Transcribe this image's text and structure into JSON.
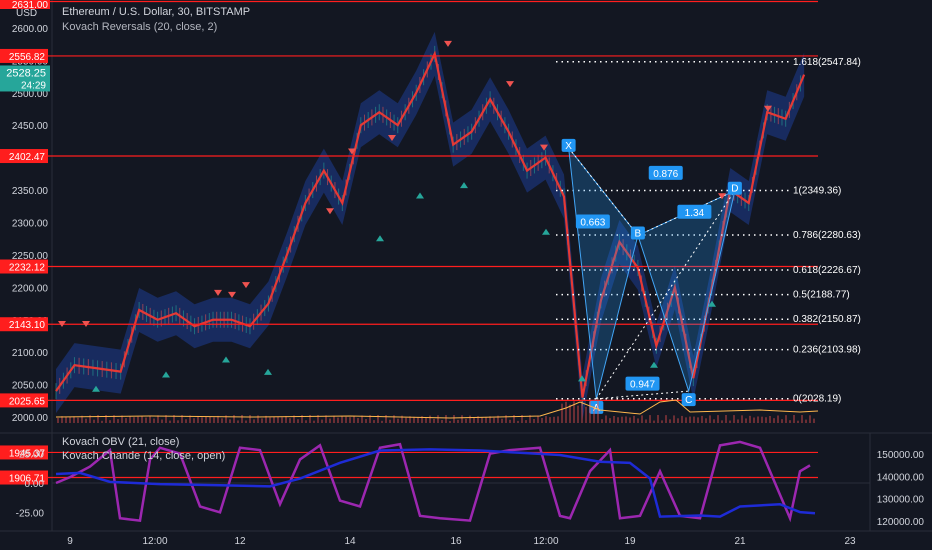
{
  "header": {
    "title": "Ethereum / U.S. Dollar, 30, BITSTAMP",
    "indicator": "Kovach Reversals (20, close, 2)",
    "currency": "USD"
  },
  "lower_pane": {
    "indicator_1": "Kovach OBV (21, close)",
    "indicator_2": "Kovach Chande (14, close, open)"
  },
  "price_axis": {
    "ticks": [
      "2600.00",
      "2550.00",
      "2500.00",
      "2450.00",
      "2400.00",
      "2350.00",
      "2300.00",
      "2250.00",
      "2200.00",
      "2150.00",
      "2100.00",
      "2050.00",
      "2000.00"
    ],
    "top_tag": "2631.00",
    "last_price": "2528.25",
    "countdown": "24:29",
    "red_tags": [
      "2556.82",
      "2402.47",
      "2232.12",
      "2143.10",
      "2025.65",
      "1945.37",
      "1906.71"
    ]
  },
  "lower_left_axis": {
    "ticks": [
      "25.00",
      "0.00",
      "-25.00"
    ]
  },
  "lower_right_axis": {
    "ticks": [
      "150000.00",
      "140000.00",
      "130000.00",
      "120000.00"
    ]
  },
  "time_axis": {
    "ticks": [
      "9",
      "12:00",
      "12",
      "14",
      "16",
      "12:00",
      "19",
      "21",
      "23"
    ]
  },
  "chart_data": {
    "type": "line",
    "title": "Ethereum / U.S. Dollar, 30, BITSTAMP",
    "x_ticks": [
      "9",
      "12:00",
      "12",
      "14",
      "16",
      "12:00",
      "19",
      "21",
      "23"
    ],
    "ylim": [
      1980,
      2640
    ],
    "horizontal_levels": [
      2556.82,
      2402.47,
      2232.12,
      2143.1,
      2025.65,
      1945.37,
      1906.71
    ],
    "price_path": [
      {
        "t": 0,
        "y": 2040
      },
      {
        "t": 4,
        "y": 2080
      },
      {
        "t": 9,
        "y": 2075
      },
      {
        "t": 14,
        "y": 2070
      },
      {
        "t": 18,
        "y": 2165
      },
      {
        "t": 22,
        "y": 2150
      },
      {
        "t": 26,
        "y": 2160
      },
      {
        "t": 30,
        "y": 2140
      },
      {
        "t": 34,
        "y": 2150
      },
      {
        "t": 38,
        "y": 2150
      },
      {
        "t": 42,
        "y": 2140
      },
      {
        "t": 46,
        "y": 2175
      },
      {
        "t": 50,
        "y": 2250
      },
      {
        "t": 54,
        "y": 2330
      },
      {
        "t": 58,
        "y": 2380
      },
      {
        "t": 62,
        "y": 2330
      },
      {
        "t": 66,
        "y": 2450
      },
      {
        "t": 70,
        "y": 2470
      },
      {
        "t": 74,
        "y": 2450
      },
      {
        "t": 78,
        "y": 2500
      },
      {
        "t": 82,
        "y": 2560
      },
      {
        "t": 86,
        "y": 2420
      },
      {
        "t": 90,
        "y": 2440
      },
      {
        "t": 94,
        "y": 2490
      },
      {
        "t": 98,
        "y": 2440
      },
      {
        "t": 102,
        "y": 2380
      },
      {
        "t": 106,
        "y": 2400
      },
      {
        "t": 110,
        "y": 2340
      },
      {
        "t": 114,
        "y": 2030
      },
      {
        "t": 118,
        "y": 2180
      },
      {
        "t": 122,
        "y": 2270
      },
      {
        "t": 126,
        "y": 2230
      },
      {
        "t": 130,
        "y": 2110
      },
      {
        "t": 134,
        "y": 2200
      },
      {
        "t": 138,
        "y": 2060
      },
      {
        "t": 142,
        "y": 2200
      },
      {
        "t": 146,
        "y": 2350
      },
      {
        "t": 150,
        "y": 2330
      },
      {
        "t": 154,
        "y": 2470
      },
      {
        "t": 158,
        "y": 2460
      },
      {
        "t": 162,
        "y": 2528
      }
    ],
    "fib_levels": [
      {
        "label": "1.618(2547.84)",
        "value": 2547.84
      },
      {
        "label": "1(2349.36)",
        "value": 2349.36
      },
      {
        "label": "0.786(2280.63)",
        "value": 2280.63
      },
      {
        "label": "0.618(2226.67)",
        "value": 2226.67
      },
      {
        "label": "0.5(2188.77)",
        "value": 2188.77
      },
      {
        "label": "0.382(2150.87)",
        "value": 2150.87
      },
      {
        "label": "0.236(2103.98)",
        "value": 2103.98
      },
      {
        "label": "0(2028.19)",
        "value": 2028.19
      }
    ],
    "pattern_points": [
      {
        "label": "X",
        "t": 111,
        "y": 2415
      },
      {
        "label": "A",
        "t": 117,
        "y": 2028
      },
      {
        "label": "B",
        "t": 126,
        "y": 2280
      },
      {
        "label": "C",
        "t": 137,
        "y": 2040
      },
      {
        "label": "D",
        "t": 147,
        "y": 2349
      }
    ],
    "ratio_labels": [
      "0.663",
      "0.876",
      "1.34",
      "0.947"
    ],
    "oscillator_ticks": [
      25,
      0,
      -25
    ],
    "obv_ticks": [
      150000,
      140000,
      130000,
      120000
    ]
  }
}
